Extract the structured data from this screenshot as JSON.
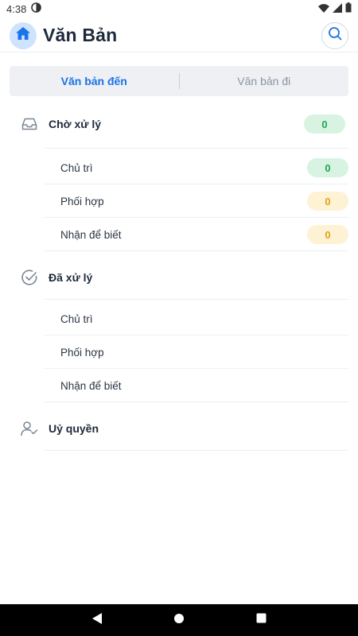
{
  "status_bar": {
    "time": "4:38"
  },
  "header": {
    "title": "Văn Bản"
  },
  "tabs": [
    {
      "label": "Văn bản đến",
      "active": true
    },
    {
      "label": "Văn bản đi",
      "active": false
    }
  ],
  "sections": {
    "pending": {
      "title": "Chờ xử lý",
      "count": "0",
      "items": [
        {
          "label": "Chủ trì",
          "count": "0"
        },
        {
          "label": "Phối hợp",
          "count": "0"
        },
        {
          "label": "Nhận để biết",
          "count": "0"
        }
      ]
    },
    "processed": {
      "title": "Đã xử lý",
      "items": [
        {
          "label": "Chủ trì"
        },
        {
          "label": "Phối hợp"
        },
        {
          "label": "Nhận để biết"
        }
      ]
    },
    "delegate": {
      "title": "Uỷ quyền"
    }
  },
  "colors": {
    "accent": "#1a73e8",
    "pill_green_bg": "#d9f3e3",
    "pill_green_text": "#22a257",
    "pill_yellow_bg": "#fdf2d4",
    "pill_yellow_text": "#e0a31a"
  },
  "icons": {
    "home": "home-icon",
    "search": "search-icon",
    "pending": "inbox-icon",
    "processed": "check-circle-icon",
    "delegate": "user-check-icon"
  }
}
